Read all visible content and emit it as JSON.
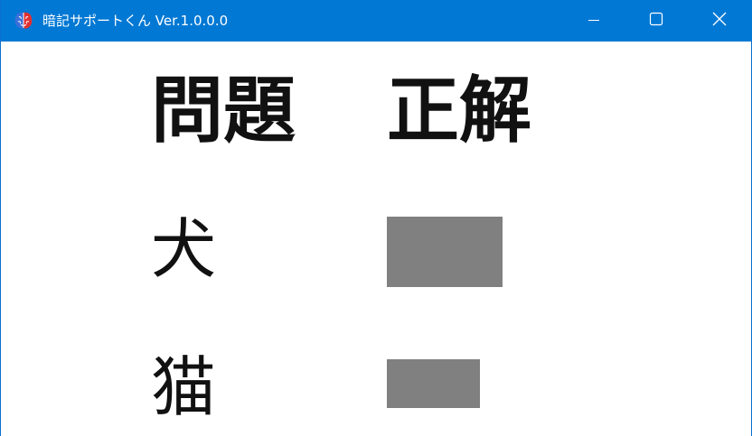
{
  "window": {
    "title": "暗記サポートくん Ver.1.0.0.0",
    "icons": {
      "app": "brain-icon",
      "minimize": "minimize-icon",
      "maximize": "maximize-icon",
      "close": "close-icon"
    },
    "colors": {
      "titlebar": "#0078d4",
      "mask": "#808080"
    }
  },
  "table": {
    "headers": {
      "question": "問題",
      "answer": "正解"
    },
    "rows": [
      {
        "question": "犬"
      },
      {
        "question": "猫"
      }
    ]
  }
}
